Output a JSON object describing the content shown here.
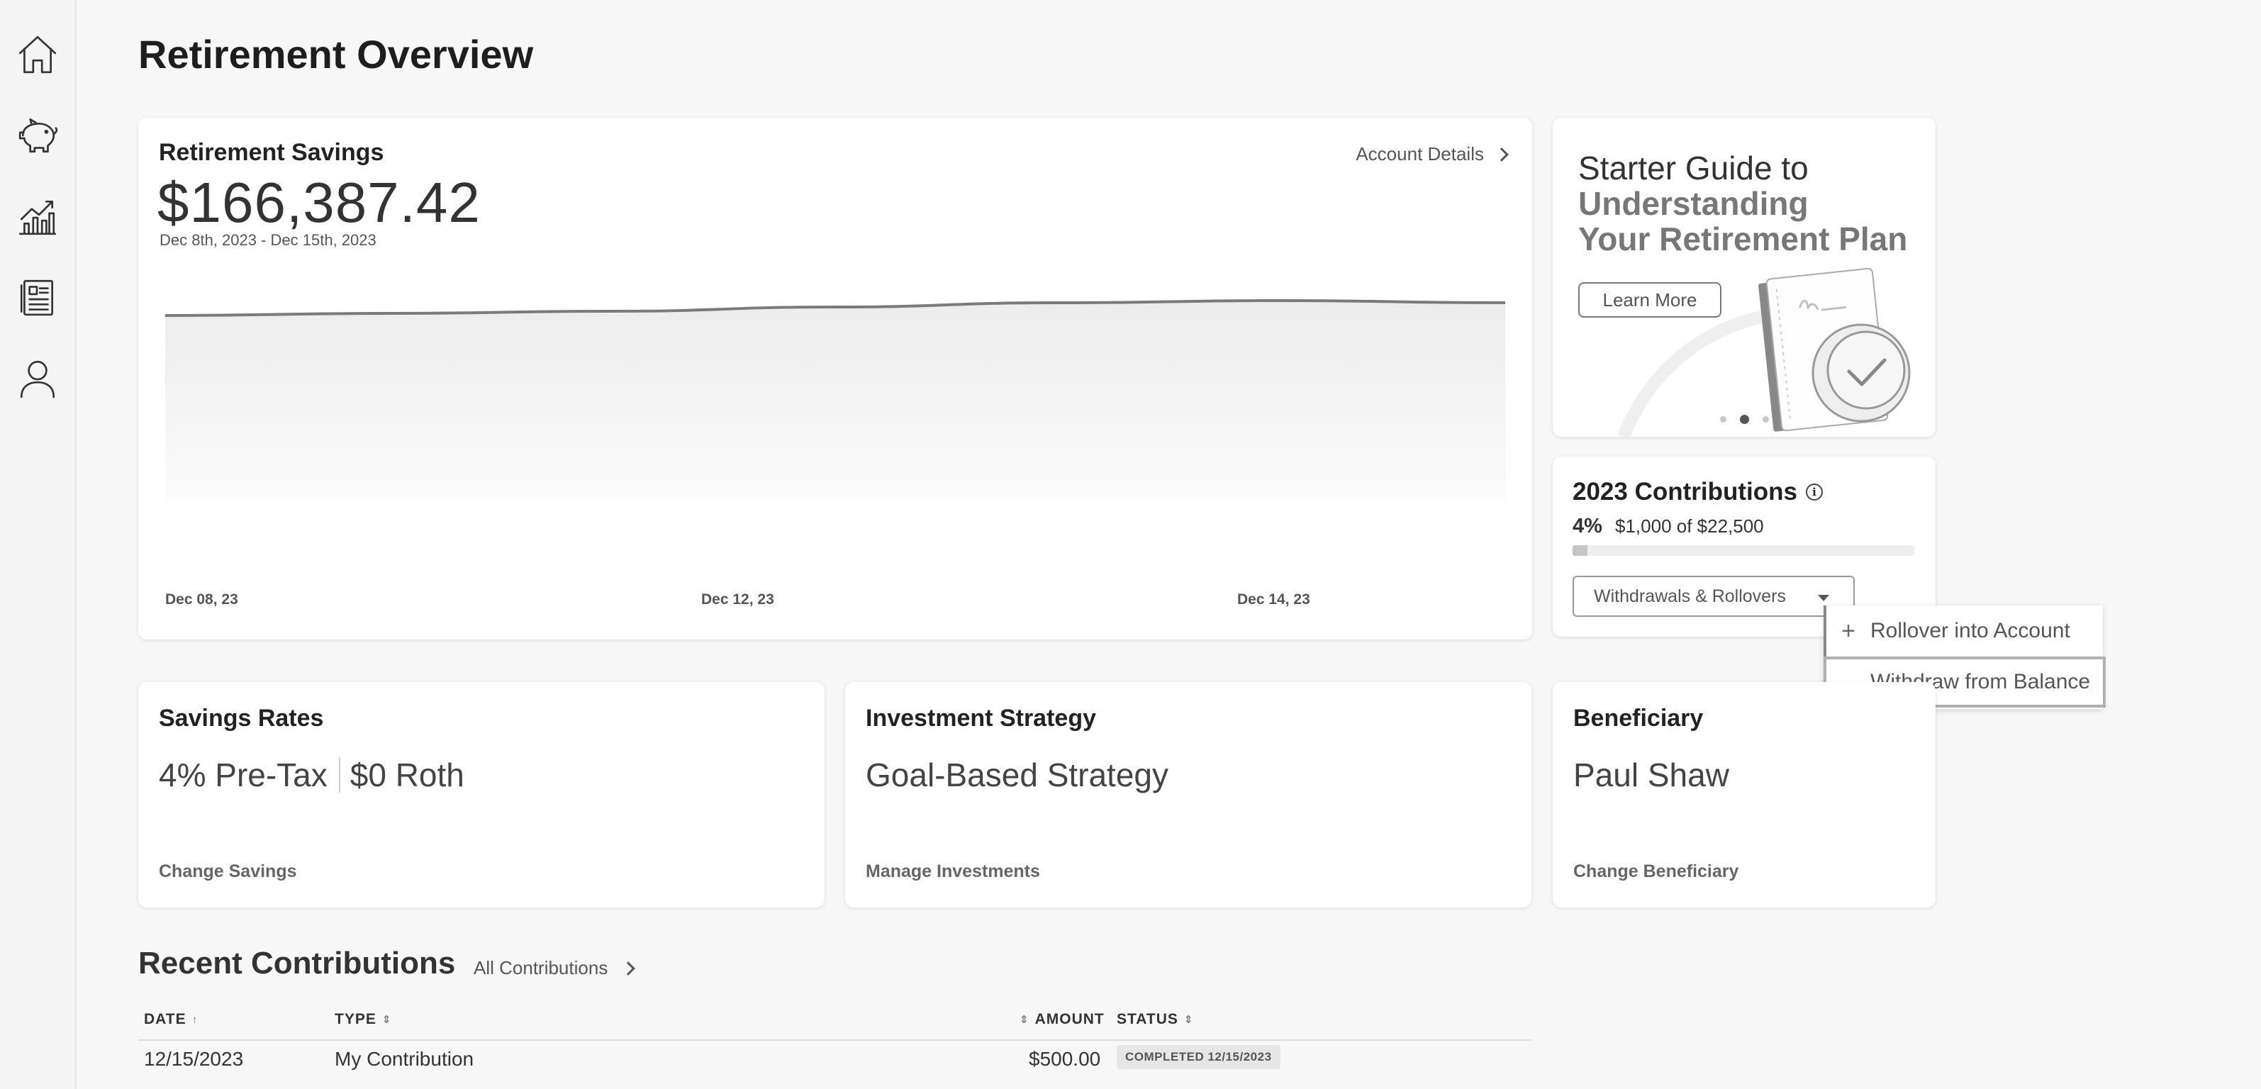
{
  "sidebar": {
    "items": [
      {
        "icon": "home-icon",
        "label": "Home"
      },
      {
        "icon": "piggy-bank-icon",
        "label": "Savings"
      },
      {
        "icon": "growth-chart-icon",
        "label": "Investments"
      },
      {
        "icon": "documents-icon",
        "label": "Documents"
      },
      {
        "icon": "user-icon",
        "label": "Profile"
      }
    ]
  },
  "page": {
    "title": "Retirement Overview"
  },
  "savings": {
    "title": "Retirement Savings",
    "amount": "$166,387.42",
    "range": "Dec 8th, 2023 - Dec 15th, 2023",
    "link": "Account Details",
    "chart_data": {
      "type": "area",
      "x_ticks": [
        "Dec 08, 23",
        "Dec 12, 23",
        "Dec 14, 23"
      ],
      "values": [
        0.87,
        0.88,
        0.89,
        0.91,
        0.93,
        0.94,
        0.93
      ],
      "grid": false,
      "legend": "none"
    }
  },
  "promo": {
    "line1": "Starter Guide to",
    "line2": "Understanding",
    "line3": "Your Retirement Plan",
    "button": "Learn More",
    "slides": 3,
    "active_slide": 2
  },
  "contributions": {
    "title": "2023 Contributions",
    "percent": "4%",
    "of_text": "$1,000 of $22,500",
    "progress_fraction": 0.0444,
    "dropdown_label": "Withdrawals & Rollovers",
    "menu": [
      {
        "icon": "plus-icon",
        "symbol": "+",
        "label": "Rollover into Account"
      },
      {
        "icon": "minus-icon",
        "symbol": "—",
        "label": "Withdraw from Balance"
      }
    ]
  },
  "rates": {
    "title": "Savings Rates",
    "pretax": "4% Pre-Tax",
    "roth": "$0 Roth",
    "link": "Change Savings"
  },
  "investment": {
    "title": "Investment Strategy",
    "value": "Goal-Based Strategy",
    "link": "Manage Investments"
  },
  "beneficiary": {
    "title": "Beneficiary",
    "value": "Paul Shaw",
    "link": "Change Beneficiary"
  },
  "recent": {
    "title": "Recent Contributions",
    "link": "All Contributions",
    "columns": {
      "date": "DATE",
      "date_sort": "↑",
      "type": "TYPE",
      "amount": "AMOUNT",
      "status": "STATUS",
      "sort_symbol": "⇕"
    },
    "rows": [
      {
        "date": "12/15/2023",
        "type": "My Contribution",
        "amount": "$500.00",
        "status": "COMPLETED 12/15/2023"
      }
    ]
  }
}
